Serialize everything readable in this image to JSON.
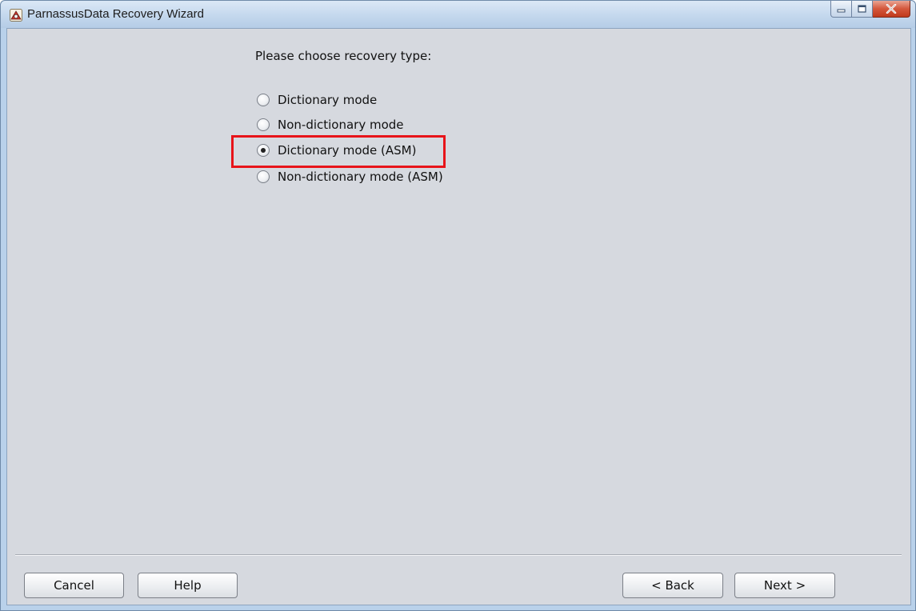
{
  "window": {
    "title": "ParnassusData Recovery Wizard"
  },
  "main": {
    "prompt": "Please choose recovery type:",
    "options": [
      {
        "label": "Dictionary mode",
        "selected": false
      },
      {
        "label": "Non-dictionary mode",
        "selected": false
      },
      {
        "label": "Dictionary mode (ASM)",
        "selected": true
      },
      {
        "label": "Non-dictionary mode (ASM)",
        "selected": false
      }
    ],
    "highlight_color": "#e8141a"
  },
  "buttons": {
    "cancel": "Cancel",
    "help": "Help",
    "back": "< Back",
    "next": "Next >"
  },
  "colors": {
    "client_background": "#d6d9df",
    "titlebar": "#c6d9ee",
    "close_button": "#d4573c"
  }
}
